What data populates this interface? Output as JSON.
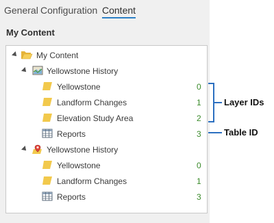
{
  "tabs": [
    {
      "label": "General"
    },
    {
      "label": "Configuration"
    },
    {
      "label": "Content",
      "active": true
    }
  ],
  "section_title": "My Content",
  "tree": {
    "root": {
      "label": "My Content",
      "icon": "folder-open-icon"
    },
    "groups": [
      {
        "label": "Yellowstone History",
        "icon": "map-icon",
        "items": [
          {
            "label": "Yellowstone",
            "icon": "polygon-layer-icon",
            "id": "0"
          },
          {
            "label": "Landform Changes",
            "icon": "polygon-layer-icon",
            "id": "1"
          },
          {
            "label": "Elevation Study Area",
            "icon": "polygon-layer-icon",
            "id": "2"
          },
          {
            "label": "Reports",
            "icon": "table-icon",
            "id": "3"
          }
        ]
      },
      {
        "label": "Yellowstone History",
        "icon": "feature-layer-icon",
        "items": [
          {
            "label": "Yellowstone",
            "icon": "polygon-layer-icon",
            "id": "0"
          },
          {
            "label": "Landform Changes",
            "icon": "polygon-layer-icon",
            "id": "1"
          },
          {
            "label": "Reports",
            "icon": "table-icon",
            "id": "3"
          }
        ]
      }
    ]
  },
  "annotations": {
    "layer_ids": "Layer IDs",
    "table_id": "Table ID"
  },
  "colors": {
    "accent": "#2a7fc5",
    "id_green": "#3a8a2a",
    "folder_yellow": "#f2c94c",
    "annotation_blue": "#2b6fc0"
  }
}
